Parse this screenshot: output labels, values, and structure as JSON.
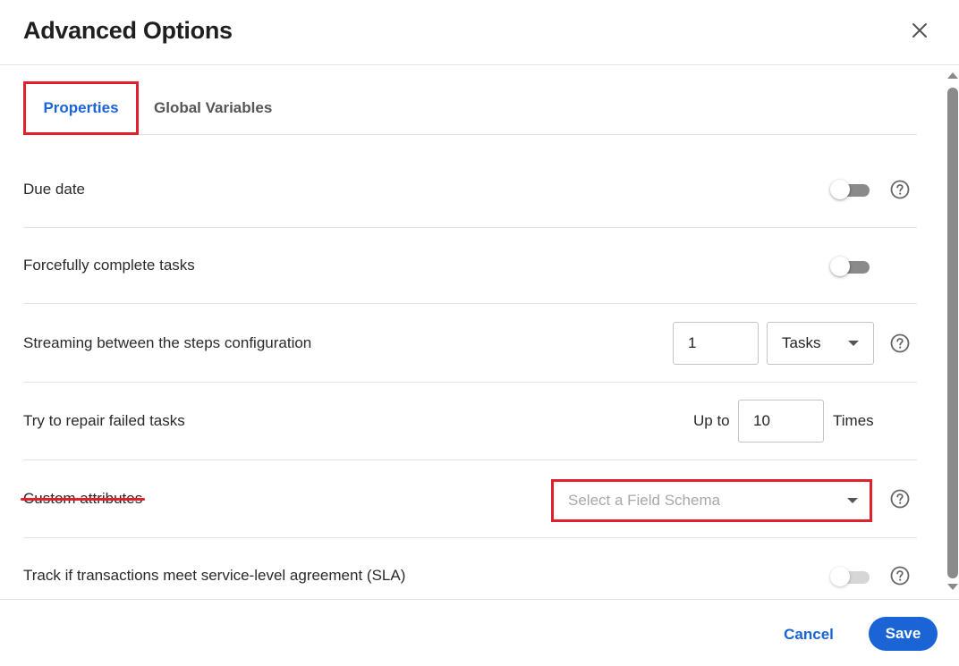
{
  "dialog": {
    "title": "Advanced Options",
    "close_icon": "close-icon"
  },
  "tabs": [
    {
      "label": "Properties",
      "active": true,
      "highlighted": true
    },
    {
      "label": "Global Variables",
      "active": false
    }
  ],
  "rows": {
    "due_date": {
      "label": "Due date",
      "toggle_on": false,
      "help_icon": "help-circle-icon"
    },
    "force_complete": {
      "label": "Forcefully complete tasks",
      "toggle_on": false
    },
    "streaming": {
      "label": "Streaming between the steps configuration",
      "count_value": "1",
      "unit_value": "Tasks",
      "help_icon": "help-circle-icon"
    },
    "repair": {
      "label": "Try to repair failed tasks",
      "prefix": "Up to",
      "times_value": "10",
      "suffix": "Times"
    },
    "custom_attributes": {
      "label": "Custom attributes",
      "select_placeholder": "Select a Field Schema",
      "help_icon": "help-circle-icon"
    },
    "sla": {
      "label": "Track if transactions meet service-level agreement (SLA)",
      "toggle_on": false,
      "toggle_disabled": true,
      "help_icon": "help-circle-icon"
    }
  },
  "footer": {
    "cancel_label": "Cancel",
    "save_label": "Save"
  },
  "colors": {
    "accent": "#1a64d6",
    "highlight": "#e0202a",
    "toggle_track": "#8a8a8a",
    "divider": "#e3e3e3"
  }
}
